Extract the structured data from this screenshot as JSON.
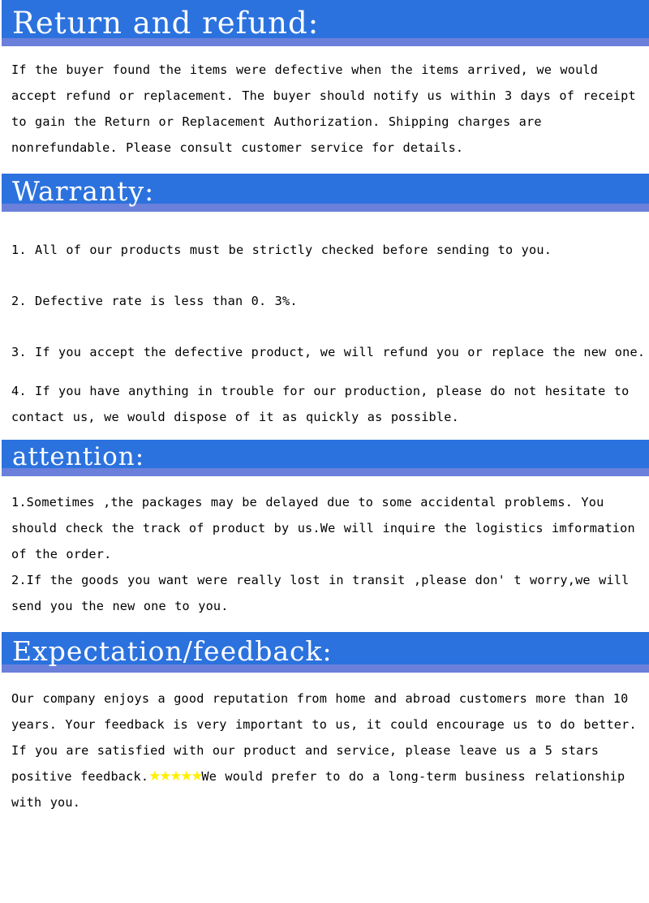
{
  "document": {
    "title": "Return and refund / Warranty / attention / Expectation-feedback policy page",
    "colors": {
      "banner_blue": "#2b72de",
      "banner_underband": "#6a80da",
      "banner_text": "#ffffff",
      "body_text": "#000000",
      "star_yellow": "#fff000",
      "page_background": "#ffffff"
    }
  },
  "sections": [
    {
      "id": "return-and-refund",
      "heading": "Return and refund:",
      "paragraphs": [
        "If the buyer found the items were defective when the items arrived, we would accept refund or replacement. The buyer should notify us within 3 days of receipt to gain the Return or Replacement Authorization. Shipping charges are nonrefundable. Please consult customer service for details."
      ]
    },
    {
      "id": "warranty",
      "heading": "Warranty:",
      "paragraphs": [
        "1. All of our products must be strictly checked before sending to you.",
        "2. Defective rate is less than 0. 3%.",
        "3. If you accept the defective product, we will refund you or replace the new one.",
        "4. If you have anything in trouble for our production, please do not hesitate to contact us, we would dispose of it as quickly as possible."
      ]
    },
    {
      "id": "attention",
      "heading": "attention:",
      "paragraphs": [
        "1.Sometimes ,the packages may be delayed due to some accidental problems. You should check the track of product by us.We will inquire the logistics imformation of the order.",
        "2.If the goods you want were really lost in transit ,please don' t worry,we will send you the new one to you."
      ]
    },
    {
      "id": "expectation-feedback",
      "heading": "Expectation/feedback:",
      "paragraphs": [
        "Our company enjoys a good reputation from home and abroad customers more than 10 years. Your feedback is very important to us, it could encourage us to do better. If you are satisfied with our product and service, please leave us a 5 stars positive feedback.",
        "We would prefer to do a long-term business relationship with you."
      ],
      "rating": {
        "icon": "star-icon",
        "count": 5,
        "glyphs": "★★★★★"
      }
    }
  ]
}
